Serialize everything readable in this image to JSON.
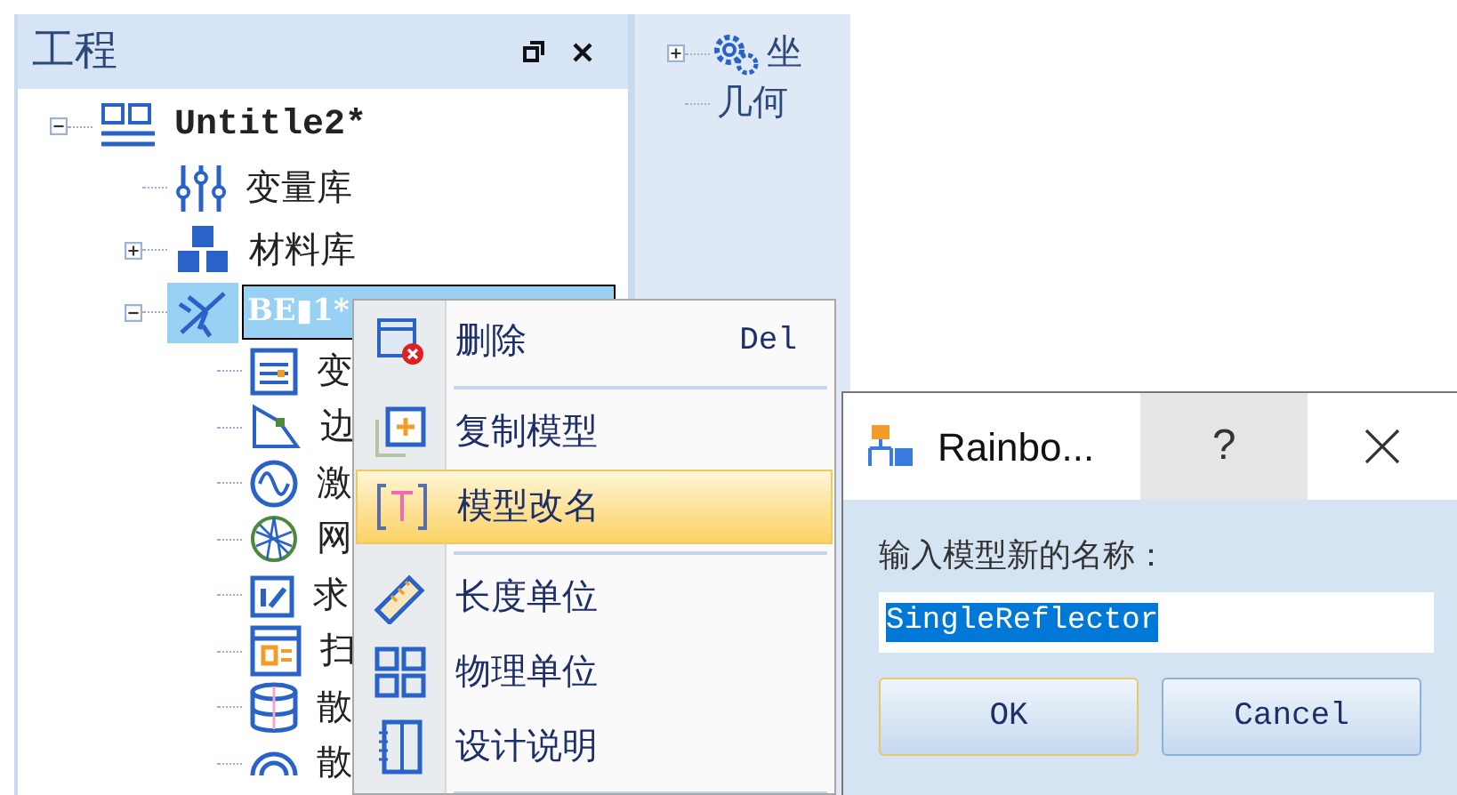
{
  "panel": {
    "title": "工程",
    "tree": [
      {
        "label": "Untitle2*",
        "expanded": true,
        "selected": false,
        "children": [
          {
            "label": "变量库",
            "selected": false
          },
          {
            "label": "材料库",
            "expanded": false,
            "selected": false
          },
          {
            "label": "BE▮1*",
            "expanded": true,
            "selected": true,
            "children": [
              {
                "label": "变",
                "selected": false
              },
              {
                "label": "边",
                "selected": false
              },
              {
                "label": "激",
                "selected": false
              },
              {
                "label": "网",
                "selected": false
              },
              {
                "label": "求",
                "selected": false
              },
              {
                "label": "扫",
                "selected": false
              },
              {
                "label": "散",
                "selected": false
              },
              {
                "label": "散",
                "selected": false
              }
            ]
          }
        ]
      }
    ]
  },
  "side_tree": [
    {
      "label": "坐",
      "expanded": false
    },
    {
      "label": "几何"
    }
  ],
  "context_menu": [
    {
      "kind": "item",
      "label": "删除",
      "shortcut": "Del",
      "selected": false
    },
    {
      "kind": "separator"
    },
    {
      "kind": "item",
      "label": "复制模型",
      "selected": false
    },
    {
      "kind": "item",
      "label": "模型改名",
      "selected": true
    },
    {
      "kind": "separator"
    },
    {
      "kind": "item",
      "label": "长度单位",
      "selected": false
    },
    {
      "kind": "item",
      "label": "物理单位",
      "selected": false
    },
    {
      "kind": "item",
      "label": "设计说明",
      "selected": false
    },
    {
      "kind": "separator"
    }
  ],
  "dialog": {
    "title": "Rainbo...",
    "help": "?",
    "prompt": "输入模型新的名称：",
    "input": {
      "value": "SingleReflector",
      "text_selected": true
    },
    "buttons": [
      {
        "label": "OK",
        "default": true
      },
      {
        "label": "Cancel",
        "default": false
      }
    ]
  }
}
